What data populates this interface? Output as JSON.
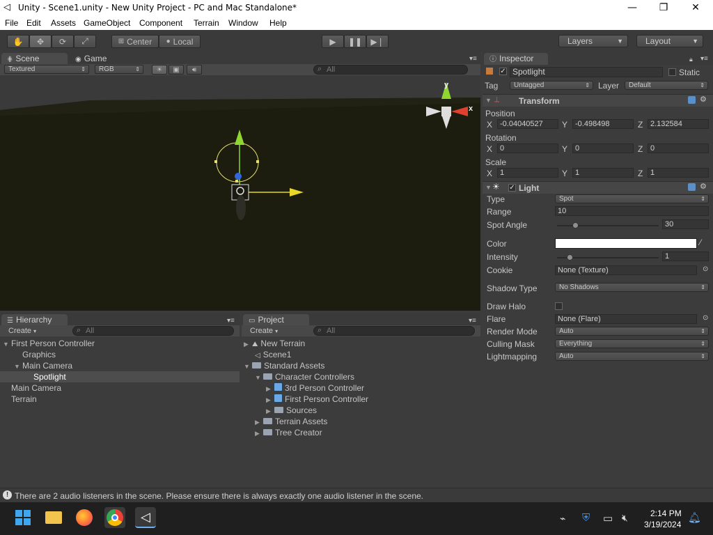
{
  "window": {
    "title": "Unity - Scene1.unity - New Unity Project - PC and Mac Standalone*",
    "minimize": "—",
    "maximize": "❐",
    "close": "✕"
  },
  "menubar": [
    "File",
    "Edit",
    "Assets",
    "GameObject",
    "Component",
    "Terrain",
    "Window",
    "Help"
  ],
  "toolbar": {
    "pivot": "Center",
    "space": "Local",
    "layers": "Layers",
    "layout": "Layout"
  },
  "scene": {
    "tab_scene": "Scene",
    "tab_game": "Game",
    "render_mode": "Textured",
    "color_mode": "RGB",
    "search_placeholder": "All",
    "axis_y": "y",
    "axis_x": "x"
  },
  "hierarchy": {
    "tab": "Hierarchy",
    "create": "Create",
    "search_placeholder": "All",
    "items": [
      {
        "label": "First Person Controller",
        "expanded": true
      },
      {
        "label": "Graphics"
      },
      {
        "label": "Main Camera",
        "expanded": true
      },
      {
        "label": "Spotlight",
        "selected": true
      },
      {
        "label": "Main Camera"
      },
      {
        "label": "Terrain"
      }
    ]
  },
  "project": {
    "tab": "Project",
    "create": "Create",
    "search_placeholder": "All",
    "items": [
      {
        "label": "New Terrain"
      },
      {
        "label": "Scene1"
      },
      {
        "label": "Standard Assets"
      },
      {
        "label": "Character Controllers"
      },
      {
        "label": "3rd Person Controller"
      },
      {
        "label": "First Person Controller"
      },
      {
        "label": "Sources"
      },
      {
        "label": "Terrain Assets"
      },
      {
        "label": "Tree Creator"
      }
    ]
  },
  "inspector": {
    "tab": "Inspector",
    "object_name": "Spotlight",
    "static_label": "Static",
    "tag_label": "Tag",
    "tag_value": "Untagged",
    "layer_label": "Layer",
    "layer_value": "Default",
    "transform": {
      "title": "Transform",
      "position_label": "Position",
      "rotation_label": "Rotation",
      "scale_label": "Scale",
      "x": "X",
      "y": "Y",
      "z": "Z",
      "position": [
        "-0.04040527",
        "-0.498498",
        "2.132584"
      ],
      "rotation": [
        "0",
        "0",
        "0"
      ],
      "scale": [
        "1",
        "1",
        "1"
      ]
    },
    "light": {
      "title": "Light",
      "type_label": "Type",
      "type_value": "Spot",
      "range_label": "Range",
      "range_value": "10",
      "spot_angle_label": "Spot Angle",
      "spot_angle_value": "30",
      "spot_angle_fraction": 0.18,
      "color_label": "Color",
      "color_value": "#ffffff",
      "intensity_label": "Intensity",
      "intensity_value": "1",
      "intensity_fraction": 0.12,
      "cookie_label": "Cookie",
      "cookie_value": "None (Texture)",
      "shadow_label": "Shadow Type",
      "shadow_value": "No Shadows",
      "halo_label": "Draw Halo",
      "flare_label": "Flare",
      "flare_value": "None (Flare)",
      "render_mode_label": "Render Mode",
      "render_mode_value": "Auto",
      "culling_label": "Culling Mask",
      "culling_value": "Everything",
      "lightmapping_label": "Lightmapping",
      "lightmapping_value": "Auto"
    }
  },
  "status": {
    "message": "There are 2 audio listeners in the scene. Please ensure there is always exactly one audio listener in the scene."
  },
  "taskbar": {
    "time": "2:14 PM",
    "date": "3/19/2024"
  },
  "colors": {
    "selection": "#4a4a4a",
    "gizmo_y": "#8fd631",
    "gizmo_x": "#e8d82a",
    "gizmo_red": "#e04030"
  }
}
